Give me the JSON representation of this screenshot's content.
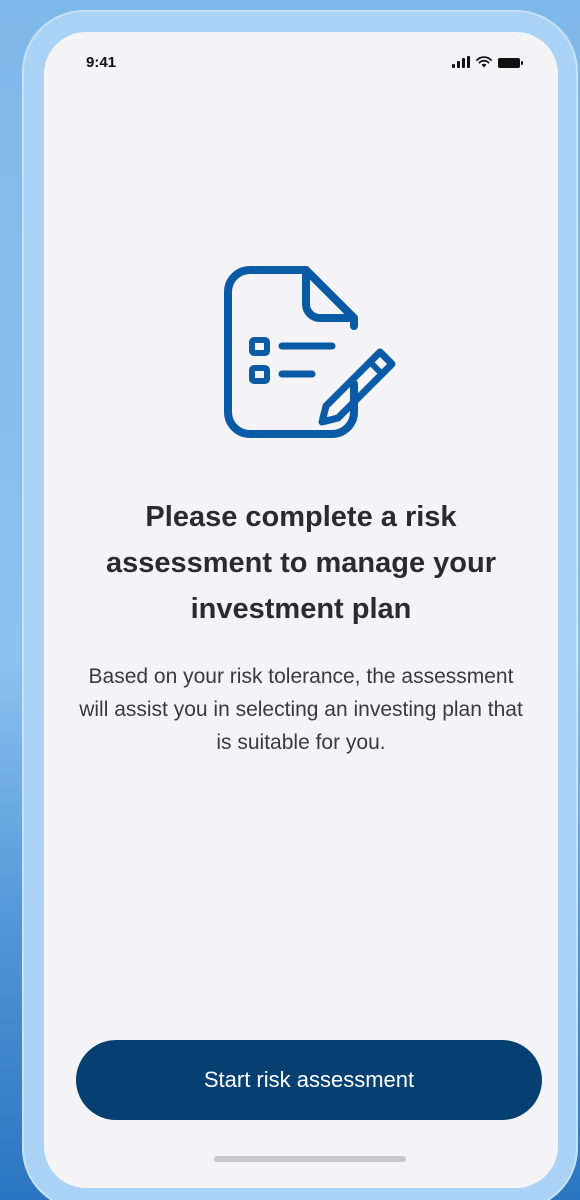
{
  "status_bar": {
    "time": "9:41",
    "icons": [
      "cellular-signal-icon",
      "wifi-icon",
      "battery-icon"
    ]
  },
  "hero": {
    "icon": "checklist-document-edit-icon",
    "icon_color": "#0a5aa5"
  },
  "content": {
    "title": "Please complete a risk assessment to manage your investment plan",
    "description": "Based on your risk tolerance, the assessment will assist you in selecting an investing plan that is suitable for you."
  },
  "actions": {
    "start_label": "Start risk assessment",
    "button_color": "#063f72"
  }
}
